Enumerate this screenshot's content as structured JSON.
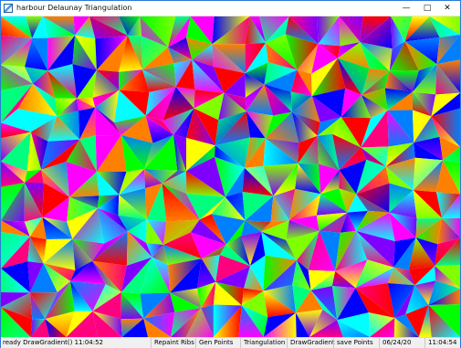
{
  "window": {
    "title": "harbour Delaunay Triangulation",
    "controls": {
      "minimize": "—",
      "maximize": "□",
      "close": "✕"
    },
    "icon": "app-window-icon"
  },
  "canvas": {
    "description": "Delaunay triangulation rendered with rainbow gradient fills"
  },
  "statusbar": {
    "left": "ready DrawGradient() 11:04:52",
    "repaint": "Repaint Ribs",
    "gen": "Gen Points",
    "triangulation": "Triangulation",
    "gradient": "DrawGradient",
    "save": "save Points",
    "date": "06/24/20",
    "time": "11:04:54"
  },
  "colors": {
    "window_border": "#2b79d8",
    "titlebar_bg": "#ffffff",
    "statusbar_bg": "#f0f0f0"
  }
}
